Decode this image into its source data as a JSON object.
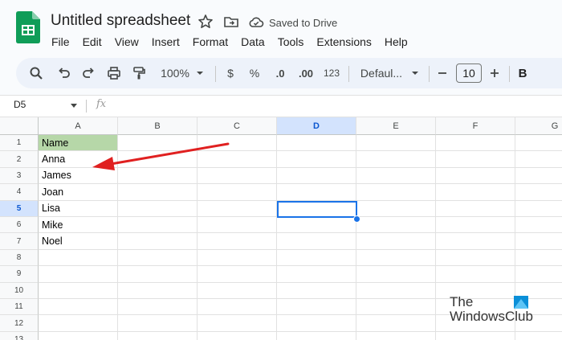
{
  "app": {
    "title": "Untitled spreadsheet",
    "saved_status": "Saved to Drive"
  },
  "menu": [
    "File",
    "Edit",
    "View",
    "Insert",
    "Format",
    "Data",
    "Tools",
    "Extensions",
    "Help"
  ],
  "toolbar": {
    "zoom": "100%",
    "currency": "$",
    "percent": "%",
    "decrease_decimal": ".0",
    "increase_decimal": ".00",
    "number_format": "123",
    "font": "Defaul...",
    "font_size": "10",
    "bold": "B"
  },
  "formula_bar": {
    "name_box": "D5",
    "fx": "fx",
    "content": ""
  },
  "columns": [
    "A",
    "B",
    "C",
    "D",
    "E",
    "F",
    "G"
  ],
  "rows": [
    "1",
    "2",
    "3",
    "4",
    "5",
    "6",
    "7",
    "8",
    "9",
    "10",
    "11",
    "12",
    "13"
  ],
  "cells": {
    "A1": "Name",
    "A2": "Anna",
    "A3": "James",
    "A4": "Joan",
    "A5": "Lisa",
    "A6": "Mike",
    "A7": "Noel"
  },
  "active_cell": "D5",
  "watermark": {
    "line1": "The",
    "line2": "WindowsClub"
  },
  "colors": {
    "header_fill": "#b6d7a8",
    "selection": "#1a73e8",
    "arrow": "#e02020",
    "sheets_green": "#0f9d58"
  }
}
